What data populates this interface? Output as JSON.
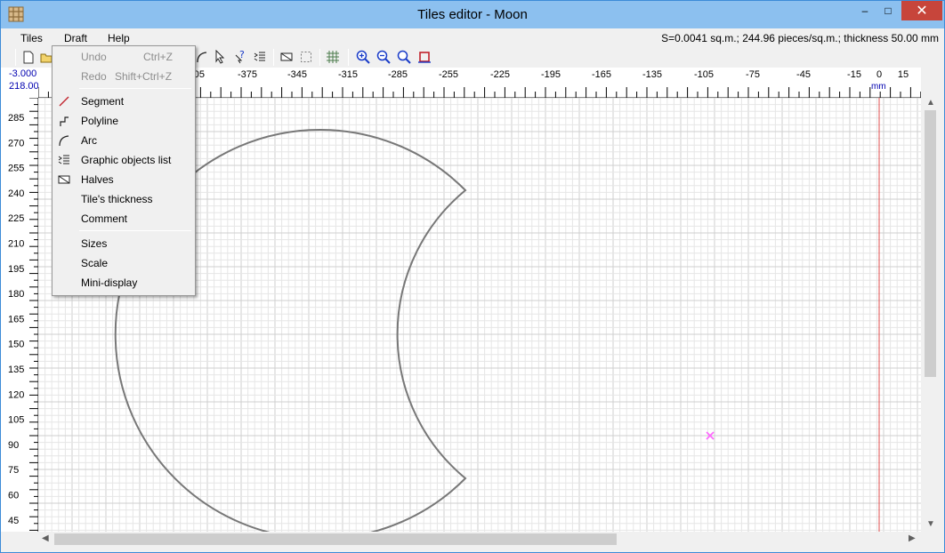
{
  "window": {
    "title": "Tiles editor - Moon",
    "controls": {
      "minimize": "–",
      "maximize": "□",
      "close": "✕"
    }
  },
  "menubar": {
    "items": [
      {
        "label": "Tiles"
      },
      {
        "label": "Draft"
      },
      {
        "label": "Help"
      }
    ],
    "status": "S=0.0041 sq.m.;  244.96 pieces/sq.m.;  thickness 50.00 mm"
  },
  "toolbar": {
    "icons": [
      "new-file-icon",
      "open-folder-icon",
      "arc-icon",
      "select-cursor-icon",
      "help-cursor-icon",
      "list-icon",
      "halves-icon",
      "selection-icon",
      "grid-icon",
      "zoom-in-icon",
      "zoom-out-icon",
      "zoom-fit-icon",
      "tile-frame-icon"
    ]
  },
  "coords": {
    "x": "-3.000",
    "y": "218.000"
  },
  "ruler": {
    "unit": "mm",
    "top_labels": [
      "-405",
      "-375",
      "-345",
      "-315",
      "-285",
      "-255",
      "-225",
      "-195",
      "-165",
      "-135",
      "-105",
      "-75",
      "-45",
      "-15",
      "0",
      "15"
    ],
    "left_labels": [
      "285",
      "270",
      "255",
      "240",
      "225",
      "210",
      "195",
      "180",
      "165",
      "150",
      "135",
      "120",
      "105",
      "90",
      "75",
      "60",
      "45"
    ]
  },
  "draft_menu": {
    "groups": [
      [
        {
          "label": "Undo",
          "shortcut": "Ctrl+Z",
          "enabled": false,
          "icon": ""
        },
        {
          "label": "Redo",
          "shortcut": "Shift+Ctrl+Z",
          "enabled": false,
          "icon": ""
        }
      ],
      [
        {
          "label": "Segment",
          "icon": "segment-icon",
          "enabled": true
        },
        {
          "label": "Polyline",
          "icon": "polyline-icon",
          "enabled": true
        },
        {
          "label": "Arc",
          "icon": "arc-icon",
          "enabled": true
        },
        {
          "label": "Graphic objects list",
          "icon": "objects-list-icon",
          "enabled": true
        },
        {
          "label": "Halves",
          "icon": "halves-icon",
          "enabled": true
        },
        {
          "label": "Tile's thickness",
          "icon": "",
          "enabled": true
        },
        {
          "label": "Comment",
          "icon": "",
          "enabled": true
        }
      ],
      [
        {
          "label": "Sizes",
          "icon": "",
          "enabled": true
        },
        {
          "label": "Scale",
          "icon": "",
          "enabled": true
        },
        {
          "label": "Mini-display",
          "icon": "",
          "enabled": true
        }
      ]
    ]
  },
  "colors": {
    "titlebar": "#8cc0ef",
    "close_button": "#c7453b",
    "coord_text": "#0000b0",
    "origin_line": "#e05050",
    "marker": "#ff66ff",
    "shape_stroke": "#777777",
    "grid_minor": "#e6e6e6",
    "grid_major": "#cfcfcf"
  }
}
